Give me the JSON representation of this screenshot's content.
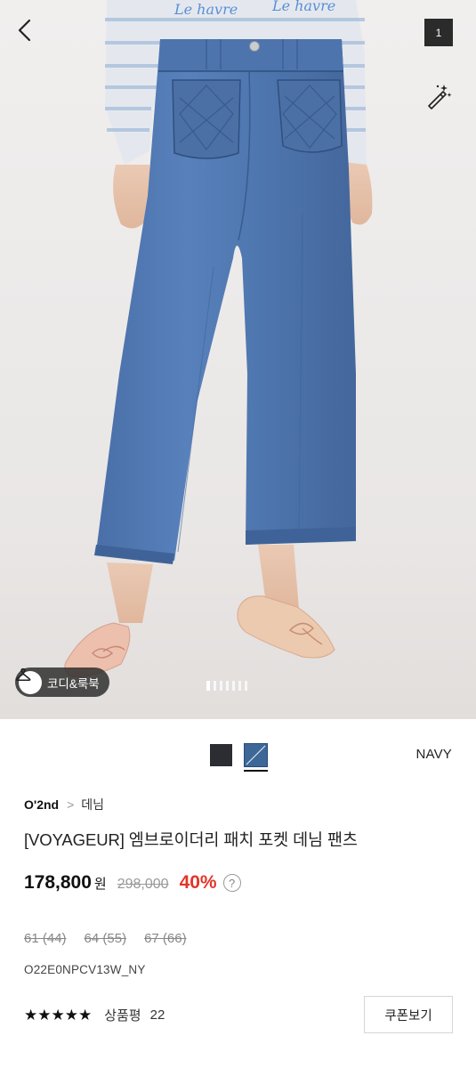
{
  "header": {
    "image_count": "1",
    "back_icon": "chevron-left-icon",
    "magic_icon": "magic-wand-icon"
  },
  "hero": {
    "sweater_text_1": "Le havre",
    "sweater_text_2": "Le havre",
    "lookbook_label": "코디&룩북",
    "lookbook_icon": "hanger-icon",
    "carousel_dots": 7,
    "carousel_active": 0
  },
  "colors": {
    "selected_name": "NAVY",
    "swatches": [
      {
        "name": "black",
        "hex": "#2c2d33"
      },
      {
        "name": "navy",
        "hex": "#3d6797"
      }
    ]
  },
  "breadcrumb": {
    "brand": "O'2nd",
    "separator": ">",
    "category": "데님"
  },
  "product": {
    "title": "[VOYAGEUR] 엠브로이더리 패치 포켓 데님 팬츠",
    "price": "178,800",
    "currency": "원",
    "original_price": "298,000",
    "discount": "40%",
    "help": "?",
    "code": "O22E0NPCV13W_NY"
  },
  "sizes": [
    "61 (44)",
    "64 (55)",
    "67 (66)"
  ],
  "reviews": {
    "stars": "★★★★★",
    "rating": 5,
    "label": "상품평",
    "count": "22"
  },
  "coupon_button": "쿠폰보기",
  "theme": {
    "discount_color": "#e3352a",
    "denim": "#4f76ad"
  }
}
